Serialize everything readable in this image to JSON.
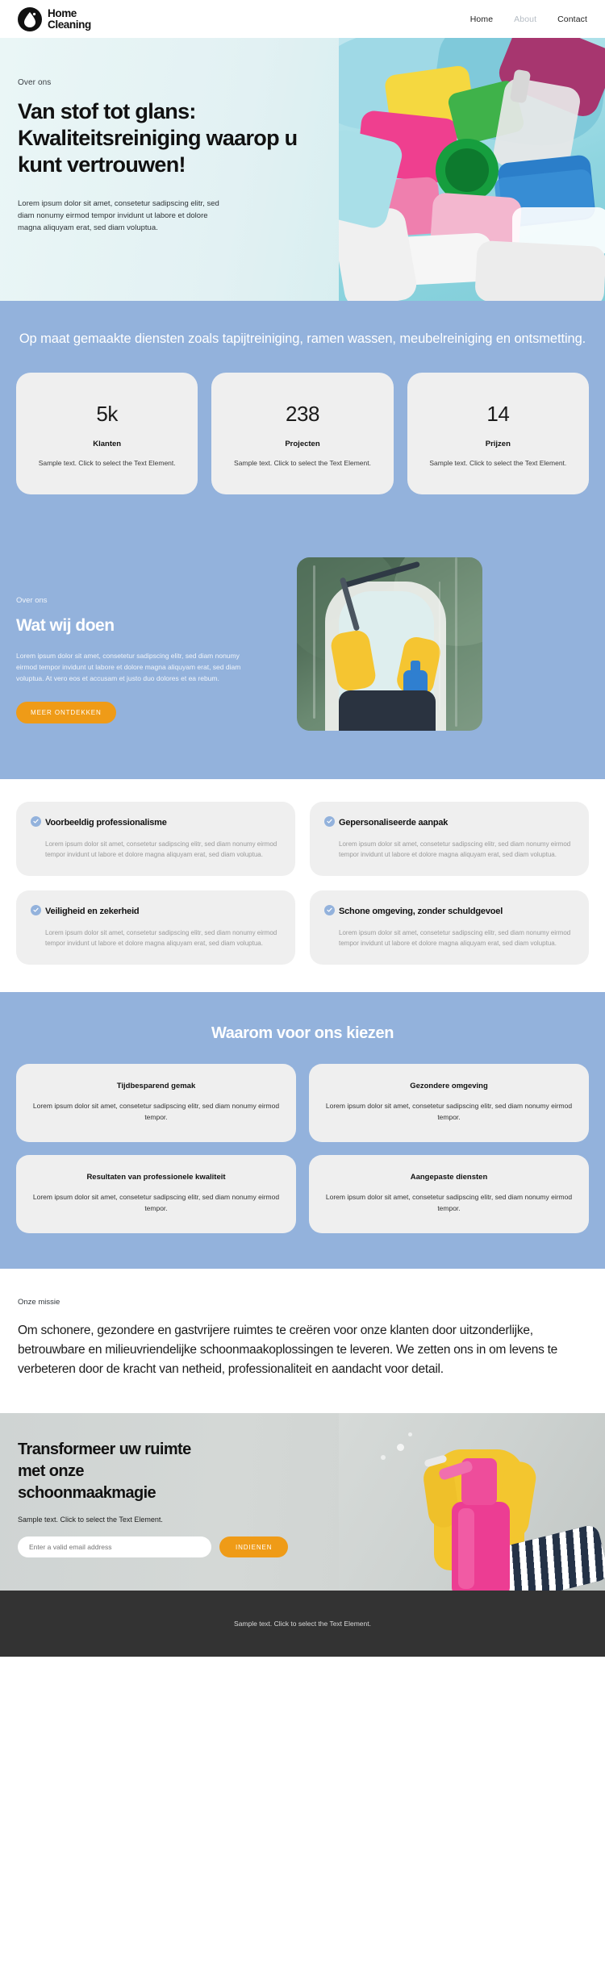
{
  "brand": {
    "name_line1": "Home",
    "name_line2": "Cleaning",
    "logo_icon": "water-drop-icon"
  },
  "nav": [
    {
      "label": "Home",
      "active": true
    },
    {
      "label": "About",
      "active": false
    },
    {
      "label": "Contact",
      "active": false
    }
  ],
  "hero": {
    "eyebrow": "Over ons",
    "title": "Van stof tot glans: Kwaliteitsreiniging waarop u kunt vertrouwen!",
    "paragraph": "Lorem ipsum dolor sit amet, consetetur sadipscing elitr, sed diam nonumy eirmod tempor invidunt ut labore et dolore magna aliquyam erat, sed diam voluptua."
  },
  "stats": {
    "heading": "Op maat gemaakte diensten zoals tapijtreiniging, ramen wassen, meubelreiniging en ontsmetting.",
    "cards": [
      {
        "number": "5k",
        "label": "Klanten",
        "description": "Sample text. Click to select the Text Element."
      },
      {
        "number": "238",
        "label": "Projecten",
        "description": "Sample text. Click to select the Text Element."
      },
      {
        "number": "14",
        "label": "Prijzen",
        "description": "Sample text. Click to select the Text Element."
      }
    ]
  },
  "what_we_do": {
    "eyebrow": "Over ons",
    "title": "Wat wij doen",
    "paragraph": "Lorem ipsum dolor sit amet, consetetur sadipscing elitr, sed diam nonumy eirmod tempor invidunt ut labore et dolore magna aliquyam erat, sed diam voluptua. At vero eos et accusam et justo duo dolores et ea rebum.",
    "button_label": "MEER ONTDEKKEN",
    "image_alt": "window-cleaning-photo"
  },
  "features": {
    "left": [
      {
        "title": "Voorbeeldig professionalisme",
        "body": "Lorem ipsum dolor sit amet, consetetur sadipscing elitr, sed diam nonumy eirmod tempor invidunt ut labore et dolore magna aliquyam erat, sed diam voluptua."
      },
      {
        "title": "Veiligheid en zekerheid",
        "body": "Lorem ipsum dolor sit amet, consetetur sadipscing elitr, sed diam nonumy eirmod tempor invidunt ut labore et dolore magna aliquyam erat, sed diam voluptua."
      }
    ],
    "right": [
      {
        "title": "Gepersonaliseerde aanpak",
        "body": "Lorem ipsum dolor sit amet, consetetur sadipscing elitr, sed diam nonumy eirmod tempor invidunt ut labore et dolore magna aliquyam erat, sed diam voluptua."
      },
      {
        "title": "Schone omgeving, zonder schuldgevoel",
        "body": "Lorem ipsum dolor sit amet, consetetur sadipscing elitr, sed diam nonumy eirmod tempor invidunt ut labore et dolore magna aliquyam erat, sed diam voluptua."
      }
    ]
  },
  "why_us": {
    "heading": "Waarom voor ons kiezen",
    "cards": [
      {
        "title": "Tijdbesparend gemak",
        "body": "Lorem ipsum dolor sit amet, consetetur sadipscing elitr, sed diam nonumy eirmod tempor."
      },
      {
        "title": "Gezondere omgeving",
        "body": "Lorem ipsum dolor sit amet, consetetur sadipscing elitr, sed diam nonumy eirmod tempor."
      },
      {
        "title": "Resultaten van professionele kwaliteit",
        "body": "Lorem ipsum dolor sit amet, consetetur sadipscing elitr, sed diam nonumy eirmod tempor."
      },
      {
        "title": "Aangepaste diensten",
        "body": "Lorem ipsum dolor sit amet, consetetur sadipscing elitr, sed diam nonumy eirmod tempor."
      }
    ]
  },
  "mission": {
    "eyebrow": "Onze missie",
    "text": "Om schonere, gezondere en gastvrijere ruimtes te creëren voor onze klanten door uitzonderlijke, betrouwbare en milieuvriendelijke schoonmaakoplossingen te leveren. We zetten ons in om levens te verbeteren door de kracht van netheid, professionaliteit en aandacht voor detail."
  },
  "cta": {
    "title": "Transformeer uw ruimte met onze schoonmaakmagie",
    "subtitle": "Sample text. Click to select the Text Element.",
    "email_placeholder": "Enter a valid email address",
    "email_value": "",
    "button_label": "INDIENEN",
    "image_alt": "spray-bottle-photo"
  },
  "footer": {
    "text": "Sample text. Click to select the Text Element."
  },
  "colors": {
    "blue_section": "#93b2dc",
    "orange_accent": "#ef9b17",
    "card_gray": "#efefef",
    "footer_dark": "#333333",
    "hero_mint": "#e6f4f4"
  }
}
